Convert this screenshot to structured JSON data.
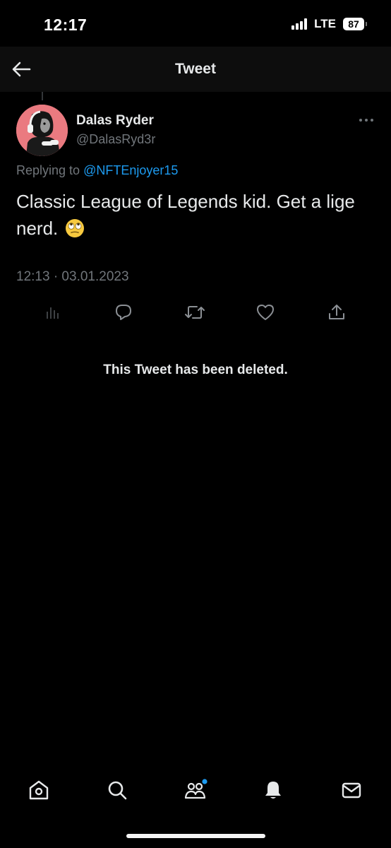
{
  "status_bar": {
    "time": "12:17",
    "network": "LTE",
    "battery": "87"
  },
  "header": {
    "title": "Tweet",
    "back_icon": "arrow-left-icon"
  },
  "tweet": {
    "author_name": "Dalas Ryder",
    "author_handle": "@DalasRyd3r",
    "reply_prefix": "Replying to",
    "reply_to": "@NFTEnjoyer15",
    "text": "Classic League of Legends kid. Get a lige nerd.",
    "emoji_icon": "eye-roll-emoji",
    "timestamp": "12:13 · 03.01.2023",
    "more_icon": "more-dots-icon",
    "actions": [
      {
        "name": "analytics",
        "icon": "bar-chart-icon"
      },
      {
        "name": "reply",
        "icon": "comment-icon"
      },
      {
        "name": "retweet",
        "icon": "retweet-icon"
      },
      {
        "name": "like",
        "icon": "heart-icon"
      },
      {
        "name": "share",
        "icon": "share-icon"
      }
    ]
  },
  "deleted_notice": "This Tweet has been deleted.",
  "bottom_nav": [
    {
      "name": "home",
      "icon": "home-icon"
    },
    {
      "name": "search",
      "icon": "search-icon"
    },
    {
      "name": "communities",
      "icon": "communities-icon",
      "badge": true
    },
    {
      "name": "notifications",
      "icon": "bell-icon"
    },
    {
      "name": "messages",
      "icon": "mail-icon"
    }
  ],
  "colors": {
    "background": "#000000",
    "accent": "#1d9bf0",
    "muted": "#71767b",
    "text": "#e7e9ea",
    "avatar_bg": "#ea7a80"
  }
}
